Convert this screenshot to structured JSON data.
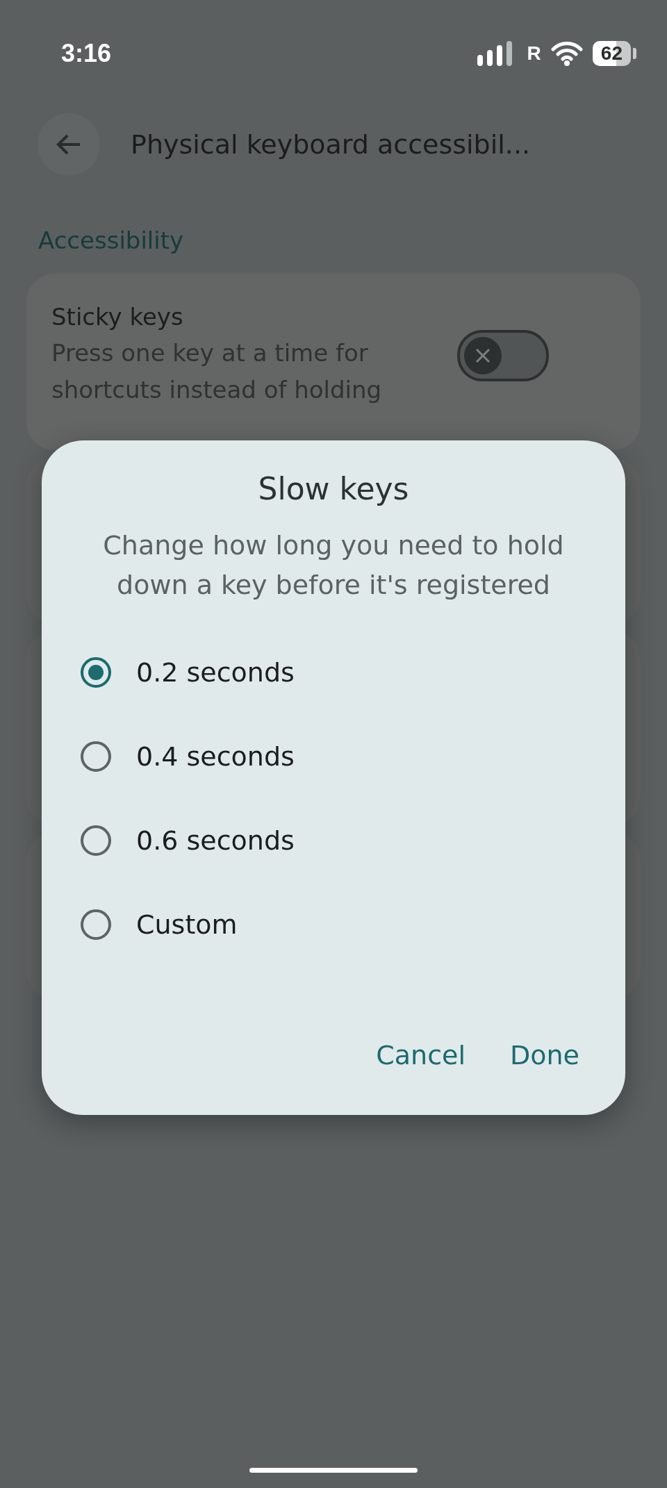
{
  "status_bar": {
    "time": "3:16",
    "network_label": "R",
    "battery": "62"
  },
  "header": {
    "title": "Physical keyboard accessibil..."
  },
  "section": {
    "title": "Accessibility"
  },
  "settings": [
    {
      "title": "Sticky keys",
      "description": "Press one key at a time for shortcuts instead of holding",
      "on": false
    }
  ],
  "dialog": {
    "title": "Slow keys",
    "description": "Change how long you need to hold down a key before it's registered",
    "options": [
      {
        "label": "0.2 seconds",
        "selected": true
      },
      {
        "label": "0.4 seconds",
        "selected": false
      },
      {
        "label": "0.6 seconds",
        "selected": false
      },
      {
        "label": "Custom",
        "selected": false
      }
    ],
    "buttons": [
      "Cancel",
      "Done"
    ]
  }
}
